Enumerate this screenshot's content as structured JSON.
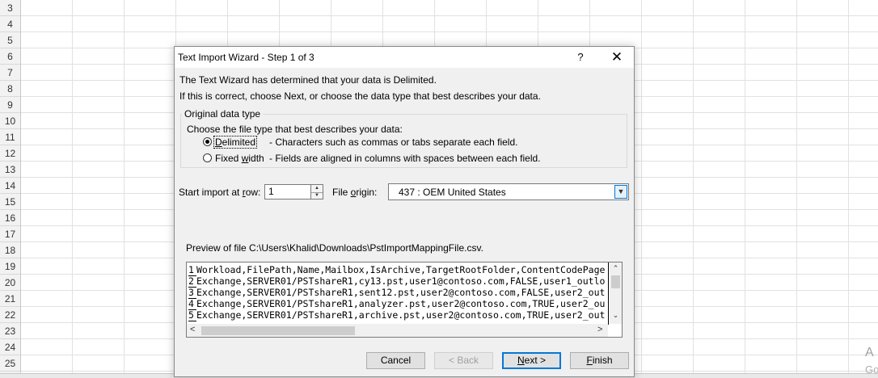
{
  "spreadsheet": {
    "row_numbers": [
      "3",
      "4",
      "5",
      "6",
      "7",
      "8",
      "9",
      "10",
      "11",
      "12",
      "13",
      "14",
      "15",
      "16",
      "17",
      "18",
      "19",
      "20",
      "21",
      "22",
      "23",
      "24",
      "25"
    ],
    "corner_text_1": "A",
    "corner_text_2": "Go"
  },
  "dialog": {
    "title": "Text Import Wizard - Step 1 of 3",
    "help_label": "?",
    "close_label": "✕",
    "intro_line1": "The Text Wizard has determined that your data is Delimited.",
    "intro_line2": "If this is correct, choose Next, or choose the data type that best describes your data.",
    "original_data_type": {
      "group_title": "Original data type",
      "prompt": "Choose the file type that best describes your data:",
      "options": [
        {
          "label_pre": "",
          "label_ul": "D",
          "label_post": "elimited",
          "description": "- Characters such as commas or tabs separate each field.",
          "selected": true
        },
        {
          "label_pre": "Fixed ",
          "label_ul": "w",
          "label_post": "idth",
          "description": "- Fields are aligned in columns with spaces between each field.",
          "selected": false
        }
      ]
    },
    "start_row": {
      "label_pre": "Start import at ",
      "label_ul": "r",
      "label_post": "ow:",
      "value": "1"
    },
    "file_origin": {
      "label_pre": "File ",
      "label_ul": "o",
      "label_post": "rigin:",
      "value": "437 : OEM United States"
    },
    "preview": {
      "caption": "Preview of file C:\\Users\\Khalid\\Downloads\\PstImportMappingFile.csv.",
      "lines": [
        {
          "n": "1",
          "text": "Workload,FilePath,Name,Mailbox,IsArchive,TargetRootFolder,ContentCodePage"
        },
        {
          "n": "2",
          "text": "Exchange,SERVER01/PSTshareR1,cy13.pst,user1@contoso.com,FALSE,user1_outlo"
        },
        {
          "n": "3",
          "text": "Exchange,SERVER01/PSTshareR1,sent12.pst,user2@contoso.com,FALSE,user2_out"
        },
        {
          "n": "4",
          "text": "Exchange,SERVER01/PSTshareR1,analyzer.pst,user2@contoso.com,TRUE,user2_ou"
        },
        {
          "n": "5",
          "text": "Exchange,SERVER01/PSTshareR1,archive.pst,user2@contoso.com,TRUE,user2_out"
        }
      ]
    },
    "buttons": {
      "cancel": "Cancel",
      "back": "< Back",
      "next_ul": "N",
      "next_post": "ext >",
      "finish_ul": "F",
      "finish_post": "inish"
    }
  }
}
